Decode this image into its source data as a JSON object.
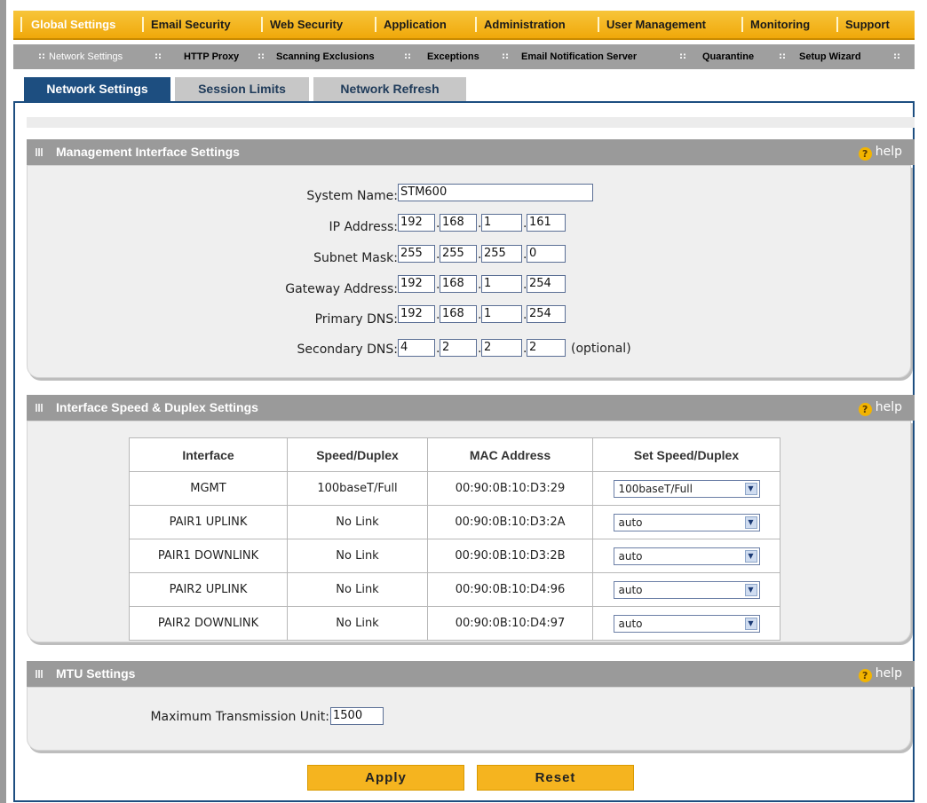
{
  "main_nav": [
    "Global Settings",
    "Email Security",
    "Web Security",
    "Application",
    "Administration",
    "User Management",
    "Monitoring",
    "Support"
  ],
  "sub_nav": [
    "Network Settings",
    "HTTP Proxy",
    "Scanning Exclusions",
    "Exceptions",
    "Email Notification Server",
    "Quarantine",
    "Setup Wizard"
  ],
  "tabs": [
    "Network Settings",
    "Session Limits",
    "Network Refresh"
  ],
  "help_label": "help",
  "management": {
    "title": "Management Interface Settings",
    "system_name_label": "System Name:",
    "system_name": "STM600",
    "ip_label": "IP Address:",
    "ip": [
      "192",
      "168",
      "1",
      "161"
    ],
    "subnet_label": "Subnet Mask:",
    "subnet": [
      "255",
      "255",
      "255",
      "0"
    ],
    "gateway_label": "Gateway Address:",
    "gateway": [
      "192",
      "168",
      "1",
      "254"
    ],
    "pdns_label": "Primary DNS:",
    "pdns": [
      "192",
      "168",
      "1",
      "254"
    ],
    "sdns_label": "Secondary DNS:",
    "sdns": [
      "4",
      "2",
      "2",
      "2"
    ],
    "optional": "(optional)"
  },
  "interface": {
    "title": "Interface Speed & Duplex Settings",
    "headers": [
      "Interface",
      "Speed/Duplex",
      "MAC Address",
      "Set Speed/Duplex"
    ],
    "rows": [
      [
        "MGMT",
        "100baseT/Full",
        "00:90:0B:10:D3:29",
        "100baseT/Full"
      ],
      [
        "PAIR1 UPLINK",
        "No Link",
        "00:90:0B:10:D3:2A",
        "auto"
      ],
      [
        "PAIR1 DOWNLINK",
        "No Link",
        "00:90:0B:10:D3:2B",
        "auto"
      ],
      [
        "PAIR2 UPLINK",
        "No Link",
        "00:90:0B:10:D4:96",
        "auto"
      ],
      [
        "PAIR2 DOWNLINK",
        "No Link",
        "00:90:0B:10:D4:97",
        "auto"
      ]
    ]
  },
  "mtu": {
    "title": "MTU Settings",
    "label": "Maximum Transmission Unit:",
    "value": "1500"
  },
  "buttons": {
    "apply": "Apply",
    "reset": "Reset"
  },
  "colors": {
    "nav_orange": "#f0a80a",
    "tab_blue": "#1d4e80",
    "section_grey": "#9a9a9a",
    "button_yellow": "#f5b41f"
  }
}
